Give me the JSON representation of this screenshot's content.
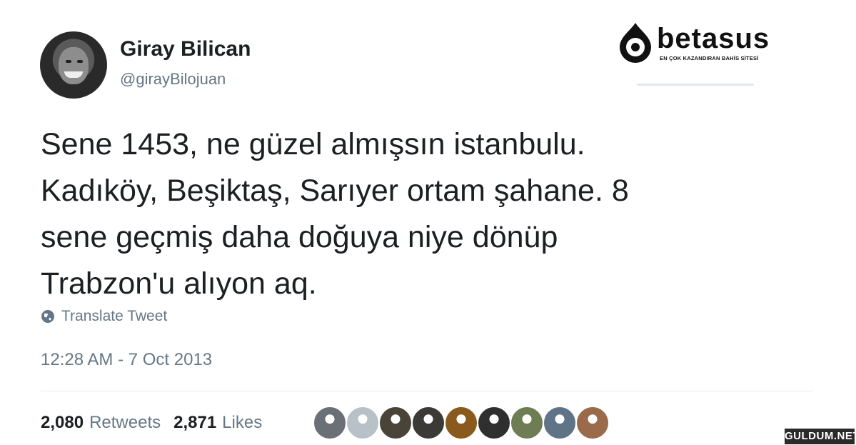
{
  "author": {
    "name": "Giray Bilican",
    "handle": "@girayBilojuan"
  },
  "logo": {
    "word": "betasus",
    "tagline": "EN ÇOK KAZANDIRAN BAHİS SİTESİ"
  },
  "tweet": {
    "lines": [
      "Sene 1453, ne güzel almışsın istanbulu.",
      "Kadıköy, Beşiktaş, Sarıyer ortam şahane. 8",
      "sene geçmiş daha doğuya niye dönüp",
      "Trabzon'u alıyon aq."
    ],
    "translate_label": "Translate Tweet",
    "timestamp": "12:28 AM - 7 Oct 2013"
  },
  "stats": {
    "retweets_count": "2,080",
    "retweets_label": "Retweets",
    "likes_count": "2,871",
    "likes_label": "Likes"
  },
  "liker_avatar_colors": [
    "#6b7077",
    "#b8c1c8",
    "#4a4438",
    "#3b3a36",
    "#8a5a1c",
    "#2f2f2f",
    "#6f7d55",
    "#5f7487",
    "#9a6a4a"
  ],
  "watermark": "GULDUM.NET"
}
